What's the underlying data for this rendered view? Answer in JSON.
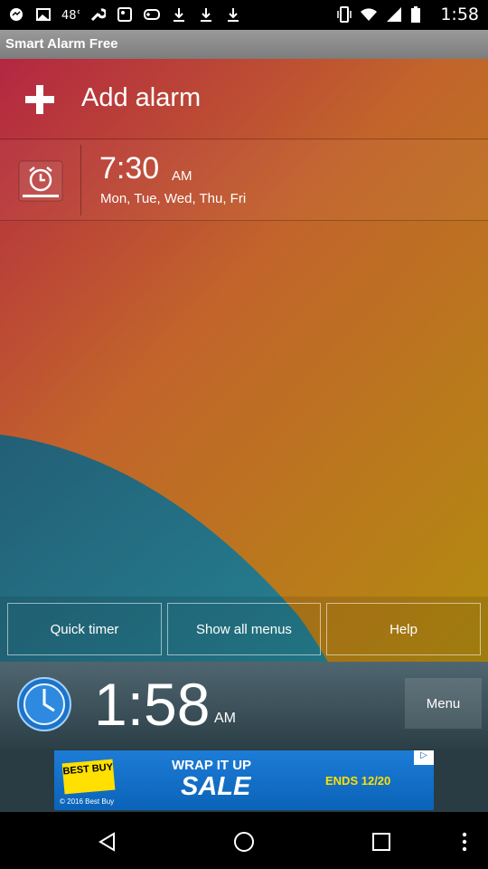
{
  "status": {
    "time": "1:58",
    "left_icons": [
      "messenger-icon",
      "image-icon",
      "notification-48-icon",
      "wrench-icon",
      "photo-icon",
      "gamepad-icon",
      "download-icon",
      "download-icon",
      "download-icon"
    ],
    "right_icons": [
      "vibrate-icon",
      "wifi-icon",
      "signal-icon",
      "battery-icon"
    ]
  },
  "app": {
    "title": "Smart Alarm Free"
  },
  "add": {
    "label": "Add alarm"
  },
  "alarm": {
    "time": "7:30",
    "ampm": "AM",
    "days": "Mon, Tue, Wed, Thu, Fri"
  },
  "buttons": {
    "quick_timer": "Quick timer",
    "show_all_menus": "Show all menus",
    "help": "Help"
  },
  "clock": {
    "time": "1:58",
    "ampm": "AM",
    "menu": "Menu"
  },
  "ad": {
    "brand": "BEST BUY",
    "copyright": "© 2016 Best Buy",
    "line1": "WRAP IT UP",
    "line2": "SALE",
    "ends": "ENDS 12/20"
  },
  "colors": {
    "top": "#b2233f",
    "mid": "#c4661e",
    "bottom": "#1b7a8a",
    "accent": "#ffffff"
  }
}
